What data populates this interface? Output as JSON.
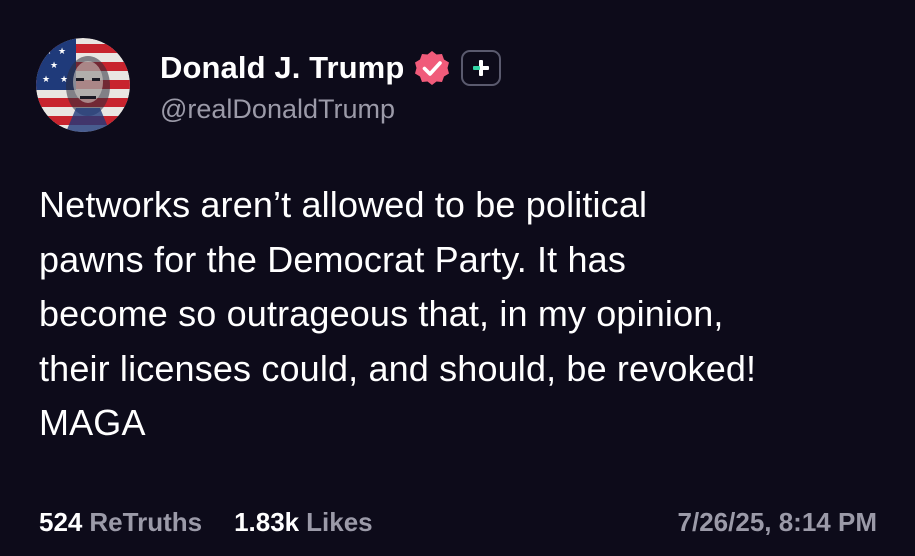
{
  "post": {
    "author": {
      "display_name": "Donald J. Trump",
      "handle": "@realDonaldTrump",
      "avatar_icon": "flag-portrait-avatar",
      "verified_icon": "verified-badge-icon",
      "follow_icon": "plus-icon"
    },
    "body": "Networks aren’t allowed to be political\npawns for the Democrat Party. It has\nbecome so outrageous that, in my opinion,\ntheir licenses could, and should, be revoked!\nMAGA",
    "stats": {
      "retruths_count": "524",
      "retruths_label": "ReTruths",
      "likes_count": "1.83k",
      "likes_label": "Likes"
    },
    "timestamp": "7/26/25, 8:14 PM"
  },
  "colors": {
    "background": "#0d0b1a",
    "text_primary": "#ffffff",
    "text_secondary": "#9b9aa8",
    "verified_badge": "#f05b7a",
    "plus_accent": "#33d6a6"
  }
}
